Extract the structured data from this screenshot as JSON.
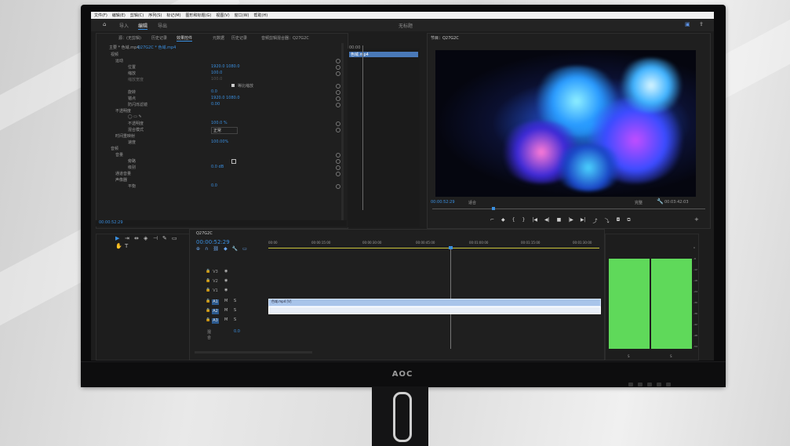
{
  "menu": [
    "文件(F)",
    "编辑(E)",
    "剪辑(C)",
    "序列(S)",
    "标记(M)",
    "图形和标题(G)",
    "视图(V)",
    "窗口(W)",
    "帮助(H)"
  ],
  "workspace": {
    "home_icon": "home-icon",
    "tabs": [
      "导入",
      "编辑",
      "导出"
    ],
    "title": "无标题"
  },
  "effect_controls": {
    "tabs": [
      "源：(无剪辑)",
      "效果控件",
      "音频剪辑混合器：Q27G2C",
      "元数据",
      "历史记录",
      "音频剪辑混合器"
    ],
    "source": "主要 * 色域.mp4",
    "clip": "Q27G2C * 色域.mp4",
    "sections": [
      "视频",
      "运动",
      "位置",
      "缩放",
      "缩放宽度",
      "旋转",
      "锚点",
      "防闪烁滤镜",
      "不透明度",
      "不透明度",
      "混合模式",
      "时间重映射",
      "速度",
      "音频",
      "音量",
      "旁路",
      "级别",
      "通道音量",
      "声像器",
      "平衡"
    ],
    "values": {
      "position": "1920.0  1080.0",
      "scale": "100.0",
      "scale_width": "100.0",
      "uniform": "等比缩放",
      "rotation": "0.0",
      "anchor": "1920.0  1080.0",
      "flicker": "0.00",
      "opacity": "100.0 %",
      "blend": "正常",
      "speed": "100.00%",
      "level": "0.0 dB",
      "balance": "0.0"
    },
    "timecode": "00:00:52:29"
  },
  "mini_timeline": {
    "time": "00:00",
    "clip": "色域.mp4"
  },
  "program": {
    "tab": "节目：Q27G2C",
    "time": "00:00:52:29",
    "fit": "适合",
    "full": "完整",
    "duration": "00:03:42:03"
  },
  "timeline": {
    "seq": "Q27G2C",
    "time": "00:00:52:29",
    "ruler": [
      "00:00",
      "00:00:15:00",
      "00:00:30:00",
      "00:00:45:00",
      "00:01:00:00",
      "00:01:15:00",
      "00:01:30:00"
    ],
    "tracks": [
      "V3",
      "V2",
      "V1",
      "A1",
      "A2",
      "A3"
    ],
    "mix": "混合",
    "mix_val": "0.0",
    "video_clip": "色域.mp4 [V]"
  },
  "meter": {
    "scale": [
      "0",
      "-6",
      "-12",
      "-18",
      "-24",
      "-30",
      "-36",
      "-42",
      "-48",
      "-54",
      "dB"
    ],
    "channels": [
      "S",
      "S"
    ],
    "level": 0.82
  },
  "monitor_brand": "AOC",
  "colors": {
    "accent": "#3a8fe0",
    "meter": "#5fd95a"
  }
}
